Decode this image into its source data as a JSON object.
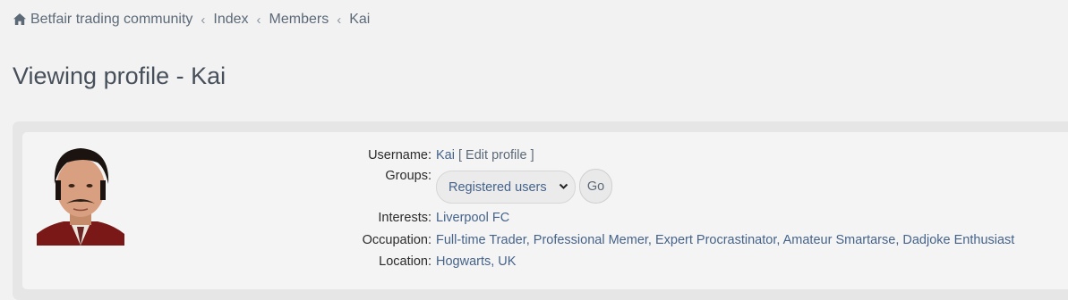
{
  "breadcrumb": {
    "icon": "home-icon",
    "items": [
      "Betfair trading community",
      "Index",
      "Members",
      "Kai"
    ],
    "separator": "‹"
  },
  "page": {
    "title": "Viewing profile - Kai"
  },
  "profile": {
    "username_label": "Username:",
    "username": "Kai",
    "edit_profile": "[ Edit profile ]",
    "groups_label": "Groups:",
    "groups_selected": "Registered users",
    "go_label": "Go",
    "interests_label": "Interests:",
    "interests": "Liverpool FC",
    "occupation_label": "Occupation:",
    "occupation": "Full-time Trader, Professional Memer, Expert Procrastinator, Amateur Smartarse, Dadjoke Enthusiast",
    "location_label": "Location:",
    "location": "Hogwarts, UK",
    "avatar": "avatar-image"
  },
  "colors": {
    "background": "#f2f2f2",
    "link": "#45638a",
    "text": "#2b2b2b",
    "breadcrumb": "#5c6a78"
  }
}
